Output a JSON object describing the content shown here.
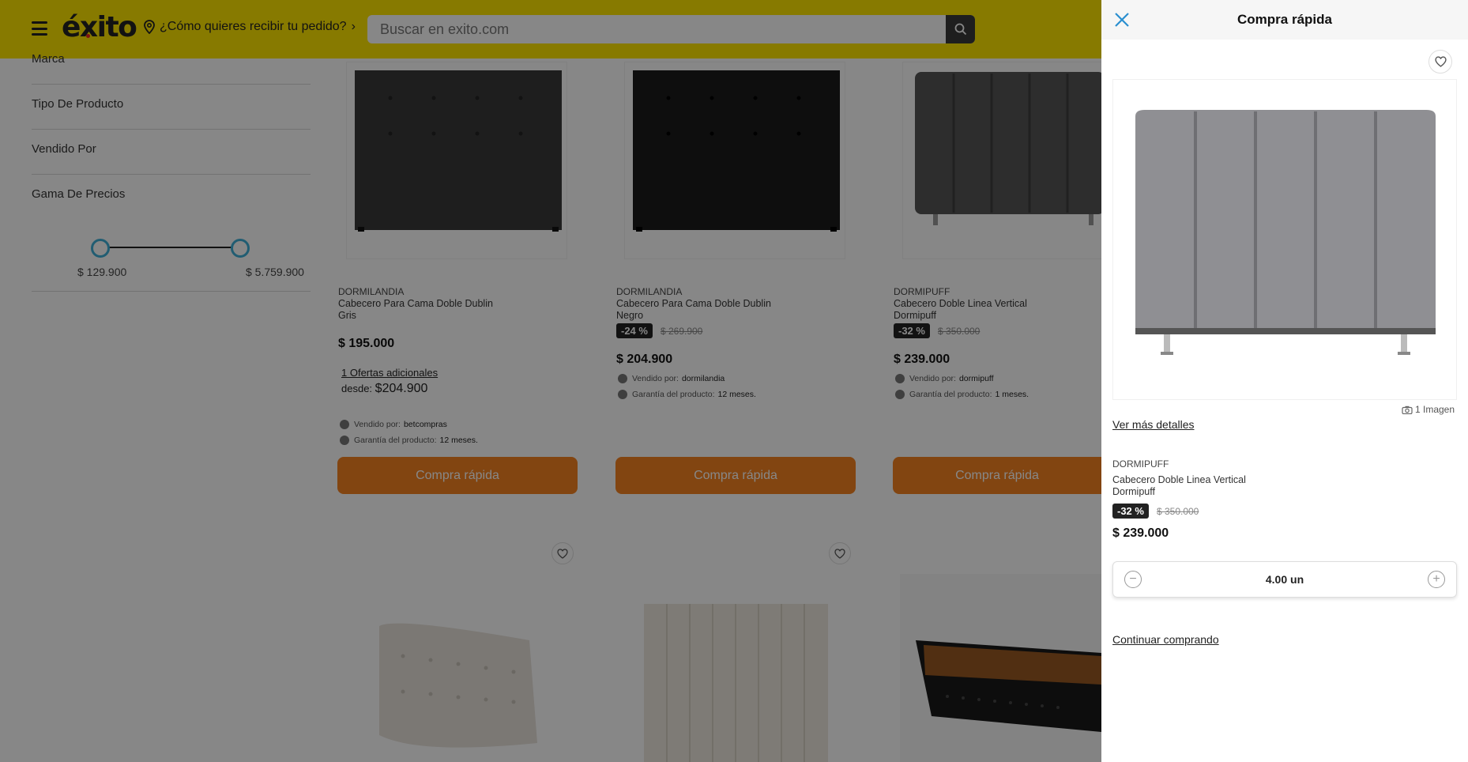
{
  "header": {
    "logo": "éxito",
    "delivery_prompt": "¿Cómo quieres recibir tu pedido?",
    "search_placeholder": "Buscar en exito.com",
    "bg_color": "#FFE600"
  },
  "filters": {
    "items": [
      "Marca",
      "Tipo De Producto",
      "Vendido Por",
      "Gama De Precios"
    ],
    "price_min": "$ 129.900",
    "price_max": "$ 5.759.900"
  },
  "products": [
    {
      "brand": "DORMILANDIA",
      "name": "Cabecero Para Cama Doble Dublin Gris",
      "price": "$ 195.000",
      "offers": "1 Ofertas adicionales",
      "desde_label": "desde:",
      "desde_price": "$204.900",
      "sold_by_label": "Vendido por:",
      "sold_by": "betcompras",
      "warranty_label": "Garantía del producto:",
      "warranty": "12 meses.",
      "button": "Compra rápida"
    },
    {
      "brand": "DORMILANDIA",
      "name": "Cabecero Para Cama Doble Dublin Negro",
      "discount": "-24 %",
      "old_price": "$ 269.900",
      "price": "$ 204.900",
      "sold_by_label": "Vendido por:",
      "sold_by": "dormilandia",
      "warranty_label": "Garantía del producto:",
      "warranty": "12 meses.",
      "button": "Compra rápida"
    },
    {
      "brand": "DORMIPUFF",
      "name": "Cabecero Doble Linea Vertical Dormipuff",
      "discount": "-32 %",
      "old_price": "$ 350.000",
      "price": "$ 239.000",
      "sold_by_label": "Vendido por:",
      "sold_by": "dormipuff",
      "warranty_label": "Garantía del producto:",
      "warranty": "1 meses.",
      "button": "Compra rápida"
    }
  ],
  "drawer": {
    "title": "Compra rápida",
    "image_count": "1 Imagen",
    "more_details": "Ver más detalles",
    "brand": "DORMIPUFF",
    "name": "Cabecero Doble Linea Vertical Dormipuff",
    "discount": "-32 %",
    "old_price": "$ 350.000",
    "price": "$ 239.000",
    "quantity": "4.00 un",
    "continue": "Continuar comprando"
  },
  "colors": {
    "accent": "#F58220",
    "slider": "#3fb0d8"
  }
}
